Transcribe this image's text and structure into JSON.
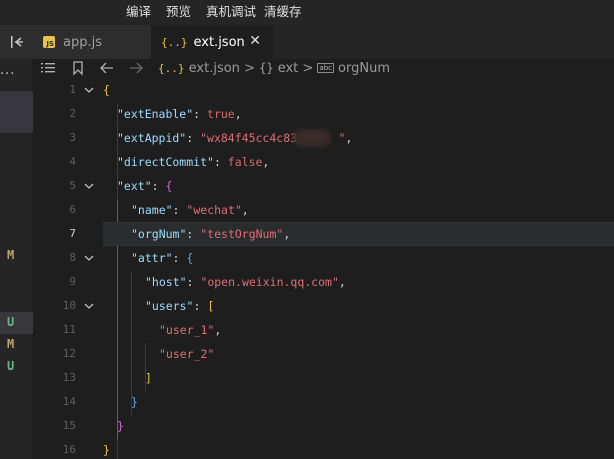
{
  "menu": [
    "编译",
    "预览",
    "真机调试",
    "清缓存"
  ],
  "sidebar": {
    "more_label": "...",
    "git_markers": [
      {
        "letter": "M",
        "kind": "modified"
      },
      {
        "letter": "U",
        "kind": "untracked"
      },
      {
        "letter": "M",
        "kind": "modified"
      },
      {
        "letter": "U",
        "kind": "untracked"
      }
    ]
  },
  "tabs": [
    {
      "label": "app.js",
      "icon": "js-file-icon",
      "active": false
    },
    {
      "label": "ext.json",
      "icon": "json-file-icon",
      "active": true,
      "close": "✕"
    }
  ],
  "breadcrumb": {
    "file": "ext.json",
    "sep": ">",
    "obj_icon": "{}",
    "obj": "ext",
    "abc": "abc",
    "prop": "orgNum",
    "json_icon": "{..}"
  },
  "editor": {
    "current_line": 7,
    "lines": [
      {
        "n": "1",
        "t": [
          [
            "br1",
            "{"
          ]
        ]
      },
      {
        "n": "2",
        "t": [
          [
            "k",
            "\"extEnable\""
          ],
          [
            "p",
            ": "
          ],
          [
            "b",
            "true"
          ],
          [
            "p",
            ","
          ]
        ]
      },
      {
        "n": "3",
        "t": [
          [
            "k",
            "\"extAppid\""
          ],
          [
            "p",
            ": "
          ],
          [
            "s",
            "\"wx84f45cc4c83"
          ],
          [
            "p",
            "      "
          ],
          [
            "s",
            "\""
          ],
          [
            "p",
            ","
          ]
        ]
      },
      {
        "n": "4",
        "t": [
          [
            "k",
            "\"directCommit\""
          ],
          [
            "p",
            ": "
          ],
          [
            "b",
            "false"
          ],
          [
            "p",
            ","
          ]
        ]
      },
      {
        "n": "5",
        "t": [
          [
            "k",
            "\"ext\""
          ],
          [
            "p",
            ": "
          ],
          [
            "br2",
            "{"
          ]
        ]
      },
      {
        "n": "6",
        "t": [
          [
            "k",
            "\"name\""
          ],
          [
            "p",
            ": "
          ],
          [
            "s",
            "\"wechat\""
          ],
          [
            "p",
            ","
          ]
        ]
      },
      {
        "n": "7",
        "t": [
          [
            "k",
            "\"orgNum\""
          ],
          [
            "p",
            ": "
          ],
          [
            "s",
            "\"testOrgNum\""
          ],
          [
            "p",
            ","
          ]
        ]
      },
      {
        "n": "8",
        "t": [
          [
            "k",
            "\"attr\""
          ],
          [
            "p",
            ": "
          ],
          [
            "br3",
            "{"
          ]
        ]
      },
      {
        "n": "9",
        "t": [
          [
            "k",
            "\"host\""
          ],
          [
            "p",
            ": "
          ],
          [
            "s",
            "\"open.weixin.qq.com\""
          ],
          [
            "p",
            ","
          ]
        ]
      },
      {
        "n": "10",
        "t": [
          [
            "k",
            "\"users\""
          ],
          [
            "p",
            ": "
          ],
          [
            "br1",
            "["
          ]
        ]
      },
      {
        "n": "11",
        "t": [
          [
            "s",
            "\"user_1\""
          ],
          [
            "p",
            ","
          ]
        ]
      },
      {
        "n": "12",
        "t": [
          [
            "s",
            "\"user_2\""
          ]
        ]
      },
      {
        "n": "13",
        "t": [
          [
            "br1",
            "]"
          ]
        ]
      },
      {
        "n": "14",
        "t": [
          [
            "br3",
            "}"
          ]
        ]
      },
      {
        "n": "15",
        "t": [
          [
            "br2",
            "}"
          ]
        ]
      },
      {
        "n": "16",
        "t": [
          [
            "br1",
            "}"
          ]
        ]
      }
    ]
  },
  "colors": {
    "background": "#1e1e1e",
    "key": "#9cdcfe",
    "string": "#e06c75",
    "git_modified": "#c0a36c",
    "git_untracked": "#6db383"
  }
}
